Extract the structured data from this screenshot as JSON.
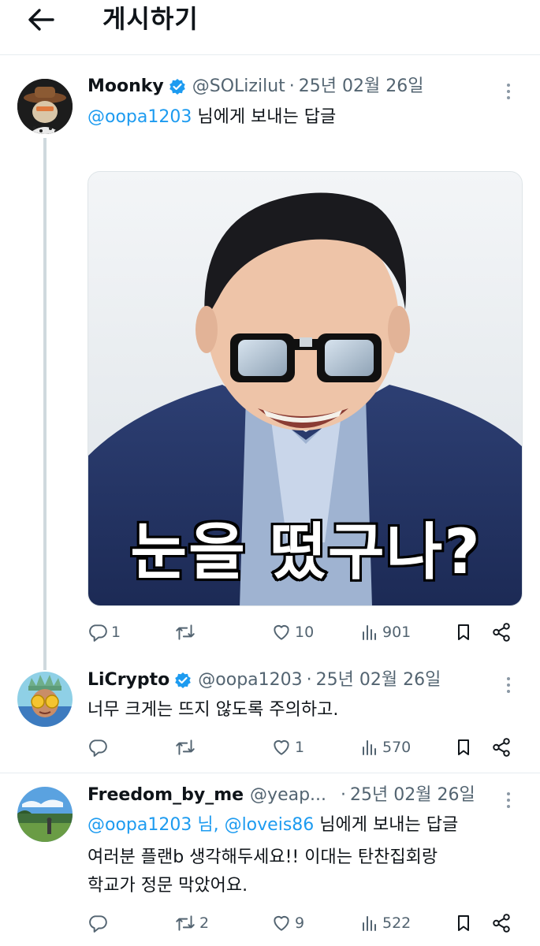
{
  "header": {
    "title": "게시하기",
    "back_icon": "arrow-left-icon"
  },
  "posts": [
    {
      "author": "Moonky",
      "handle": "@SOLizilut",
      "sep": "·",
      "date": "25년 02월 26일",
      "reply_mention": "@oopa1203",
      "reply_suffix": " 님에게 보내는 답글",
      "media_caption": "눈을 떴구나?",
      "stats": {
        "replies": "1",
        "retweets": "",
        "likes": "10",
        "views": "901"
      }
    },
    {
      "author": "LiCrypto",
      "handle": "@oopa1203",
      "sep": "·",
      "date": "25년 02월 26일",
      "text": "너무 크게는 뜨지 않도록 주의하고.",
      "stats": {
        "replies": "",
        "retweets": "",
        "likes": "1",
        "views": "570"
      }
    },
    {
      "author": "Freedom_by_me",
      "handle": "@yeap...",
      "sep": "·",
      "date": "25년 02월 26일",
      "reply_mention": "@oopa1203 님, @loveis86",
      "reply_suffix": " 님에게 보내는 답글",
      "text_lines": [
        "여러분 플랜b 생각해두세요!! 이대는 탄찬집회랑",
        "학교가 정문 막았어요."
      ],
      "stats": {
        "replies": "",
        "retweets": "2",
        "likes": "9",
        "views": "522"
      }
    }
  ],
  "colors": {
    "link": "#1d9bf0",
    "verified": "#1d9bf0",
    "muted": "#536471",
    "text": "#0f1419"
  },
  "icons": [
    "reply-icon",
    "retweet-icon",
    "like-icon",
    "views-icon",
    "bookmark-icon",
    "share-icon",
    "verified-badge-icon",
    "more-icon"
  ]
}
